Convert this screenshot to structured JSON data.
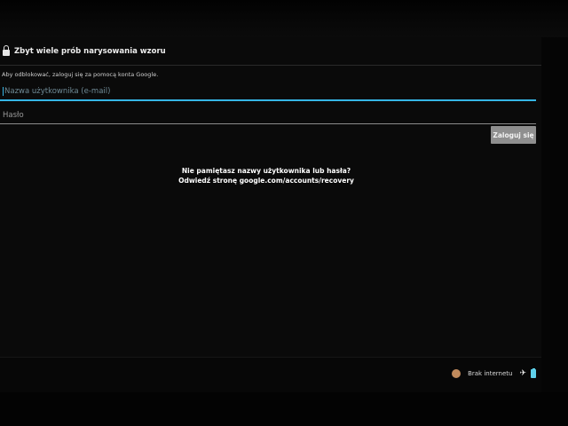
{
  "header": {
    "title": "Zbyt wiele prób narysowania wzoru",
    "lock_icon": "lock-icon"
  },
  "instruction": "Aby odblokować, zaloguj się za pomocą konta Google.",
  "username": {
    "placeholder": "Nazwa użytkownika (e-mail)",
    "value": ""
  },
  "password": {
    "placeholder": "Hasło",
    "value": ""
  },
  "login_button": "Zaloguj się",
  "recovery": {
    "line1": "Nie pamiętasz nazwy użytkownika lub hasła?",
    "line2": "Odwiedź stronę google.com/accounts/recovery"
  },
  "status_bar": {
    "network_text": "Brak internetu",
    "icons": [
      "notification-icon",
      "airplane-mode-icon",
      "battery-icon"
    ]
  },
  "colors": {
    "accent": "#35b5e5",
    "button": "#8f8f8f",
    "background": "#0a0a0a"
  }
}
